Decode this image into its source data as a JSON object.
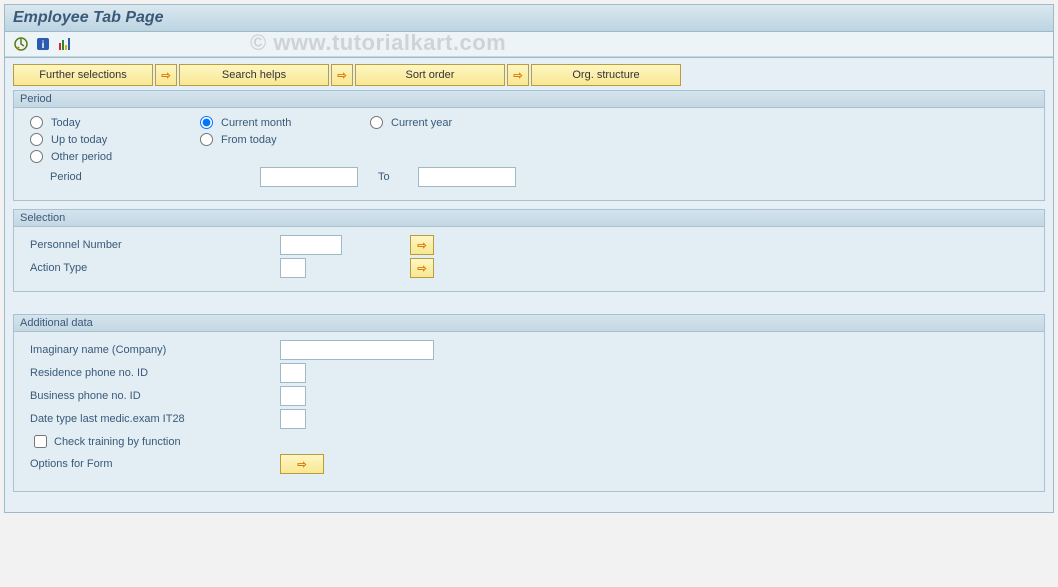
{
  "title": "Employee Tab Page",
  "watermark": "© www.tutorialkart.com",
  "top_buttons": {
    "further_selections": "Further selections",
    "search_helps": "Search helps",
    "sort_order": "Sort order",
    "org_structure": "Org. structure"
  },
  "period": {
    "legend": "Period",
    "today": "Today",
    "current_month": "Current month",
    "current_year": "Current year",
    "up_to_today": "Up to today",
    "from_today": "From today",
    "other_period": "Other period",
    "period_label": "Period",
    "to_label": "To",
    "period_from_value": "",
    "period_to_value": "",
    "selected": "current_month"
  },
  "selection": {
    "legend": "Selection",
    "personnel_number": "Personnel Number",
    "personnel_number_value": "",
    "action_type": "Action Type",
    "action_type_value": ""
  },
  "additional": {
    "legend": "Additional data",
    "imaginary_name": "Imaginary name (Company)",
    "imaginary_name_value": "",
    "residence_phone": "Residence phone no. ID",
    "residence_phone_value": "",
    "business_phone": "Business phone no. ID",
    "business_phone_value": "",
    "date_type": "Date type last medic.exam IT28",
    "date_type_value": "",
    "check_training": "Check training by function",
    "check_training_checked": false,
    "options_form": "Options for Form"
  }
}
